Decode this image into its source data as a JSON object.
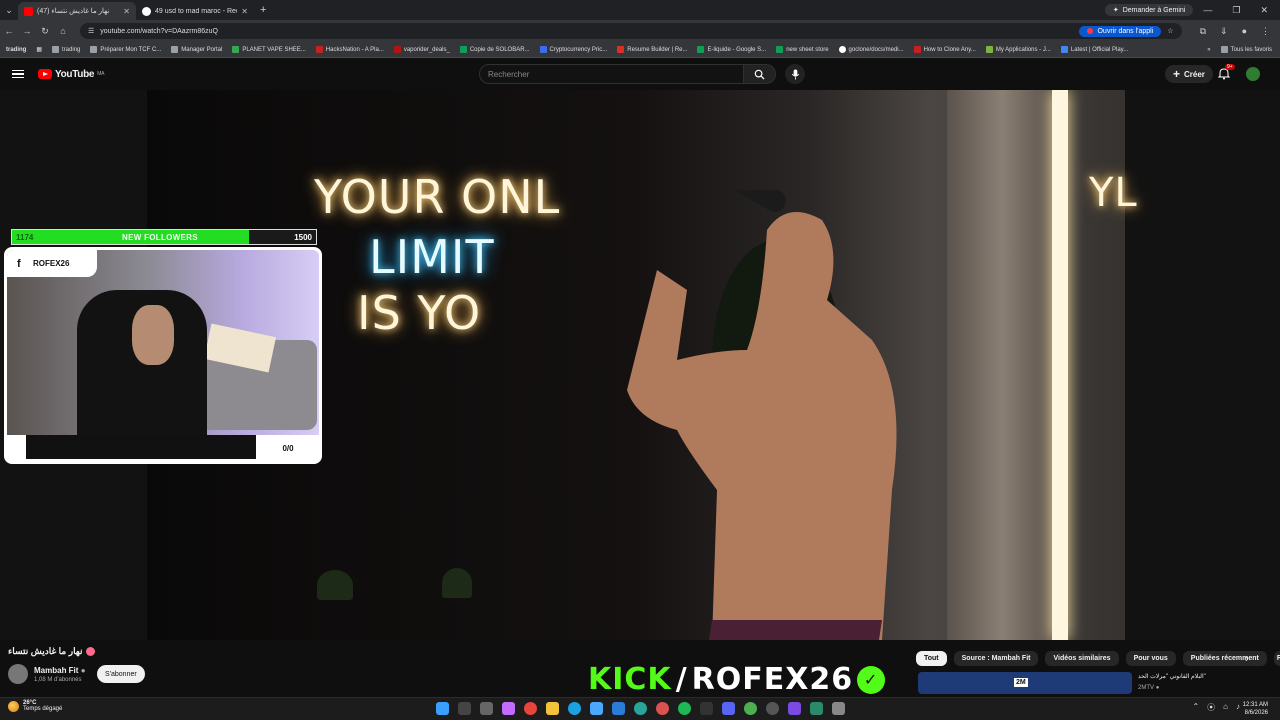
{
  "browser": {
    "tabs": [
      {
        "title": "(47) نهار ما غاديش نتساء",
        "active": true,
        "favicon": "youtube-icon"
      },
      {
        "title": "49 usd to mad maroc - Recherc",
        "active": false,
        "favicon": "google-icon"
      }
    ],
    "gemini_label": "Demander à Gemini",
    "url": "youtube.com/watch?v=DAazrm86zuQ",
    "open_app_label": "Ouvrir dans l'appli",
    "bookmarks": [
      "trading",
      "Préparer Mon TCF C...",
      "Manager Portal",
      "PLANET VAPE SHEE...",
      "HacksNation - A Pla...",
      "vaporider_deals_",
      "Copie de SOLOBAR...",
      "Cryptocurrency Pric...",
      "Resume Builder | Re...",
      "E-liquide - Google S...",
      "new sheet store",
      "goclone/docs/medi...",
      "How to Clone Any...",
      "My Applications - J...",
      "Latest | Official Play..."
    ],
    "bookmarks_pinned": "trading",
    "all_bookmarks_label": "Tous les favoris"
  },
  "youtube": {
    "logo_text": "YouTube",
    "region": "MA",
    "search_placeholder": "Rechercher",
    "create_label": "Créer",
    "notif_count": "9+"
  },
  "video": {
    "neon_line1": "YOUR ONL",
    "neon_line2": "LIMIT",
    "neon_line3": "IS YO",
    "neon_right": "YL"
  },
  "overlay": {
    "followers_current": "1174",
    "followers_label": "NEW FOLLOWERS",
    "followers_goal": "1500",
    "followers_progress": 0.78,
    "social_handle": "ROFEX26",
    "counter": "0/0"
  },
  "below": {
    "video_title": "نهار ما غاديش نتساء",
    "channel_name": "Mambah Fit",
    "subscribers": "1,08 M d'abonnés",
    "subscribe_label": "S'abonner",
    "kick_left": "KICK",
    "kick_slash": "/",
    "kick_right": "ROFEX26",
    "chips": [
      "Tout",
      "Source : Mambah Fit",
      "Vidéos similaires",
      "Pour vous",
      "Publiées récemment",
      "R"
    ],
    "related_badge": "2M",
    "related_title": "البلام القانوني \"مرلات الحد\"",
    "related_channel": "2MTV"
  },
  "taskbar": {
    "temp": "26°C",
    "weather": "Temps dégagé",
    "time": "12:31 AM",
    "date": "8/6/2026"
  }
}
